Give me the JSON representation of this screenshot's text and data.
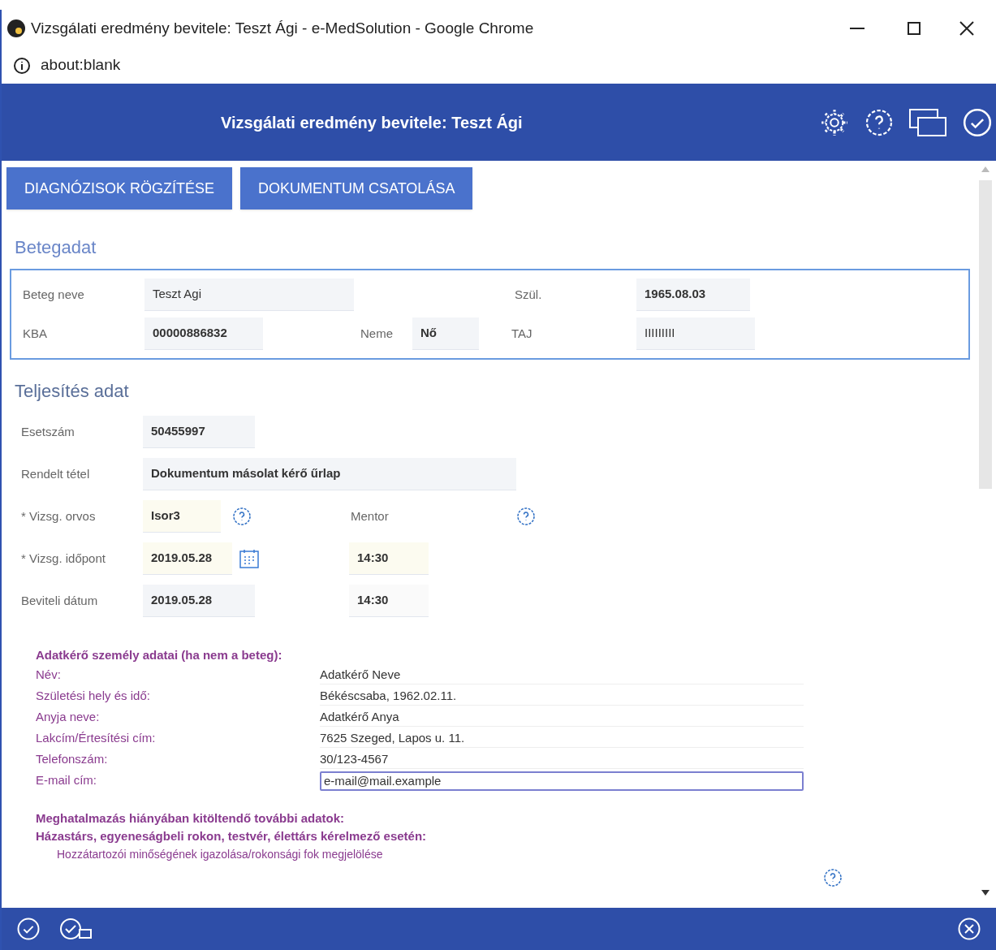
{
  "window": {
    "title": "Vizsgálati eredmény bevitele: Teszt Ági - e-MedSolution - Google Chrome",
    "address": "about:blank"
  },
  "header": {
    "title": "Vizsgálati eredmény bevitele: Teszt Ági"
  },
  "action_buttons": [
    "DIAGNÓZISOK RÖGZÍTÉSE",
    "DOKUMENTUM CSATOLÁSA"
  ],
  "patient": {
    "title": "Betegadat",
    "name_label": "Beteg neve",
    "name": "Teszt Agi",
    "birth_label": "Szül.",
    "birth": "1965.08.03",
    "kba_label": "KBA",
    "kba": "00000886832",
    "sex_label": "Neme",
    "sex": "Nő",
    "taj_label": "TAJ",
    "taj": "IIIIIIIII"
  },
  "fulfilment": {
    "title": "Teljesítés adat",
    "case_label": "Esetszám",
    "case": "50455997",
    "item_label": "Rendelt tétel",
    "item": "Dokumentum másolat kérő űrlap",
    "doctor_label": "* Vizsg. orvos",
    "doctor": "Isor3",
    "mentor_label": "Mentor",
    "time_label": "* Vizsg. időpont",
    "date": "2019.05.28",
    "time": "14:30",
    "entry_label": "Beviteli dátum",
    "entry_date": "2019.05.28",
    "entry_time": "14:30"
  },
  "requester": {
    "title": "Adatkérő személy adatai (ha nem a beteg):",
    "rows": [
      {
        "label": "Név:",
        "value": "Adatkérő Neve",
        "kind": "text"
      },
      {
        "label": "Születési hely és idő:",
        "value": "Békéscsaba, 1962.02.11.",
        "kind": "text"
      },
      {
        "label": "Anyja neve:",
        "value": "Adatkérő Anya",
        "kind": "text"
      },
      {
        "label": "Lakcím/Értesítési cím:",
        "value": "7625 Szeged, Lapos u. 11.",
        "kind": "text"
      },
      {
        "label": "Telefonszám:",
        "value": "30/123-4567",
        "kind": "text"
      },
      {
        "label": "E-mail cím:",
        "value": "e-mail@mail.example",
        "kind": "input"
      }
    ]
  },
  "authorization": {
    "title": "Meghatalmazás hiányában kitöltendő további adatok:",
    "subtitle": "Házastárs, egyeneságbeli rokon, testvér, élettárs kérelmező esetén:",
    "note": "Hozzátartozói minőségének igazolása/rokonsági fok megjelölése"
  }
}
